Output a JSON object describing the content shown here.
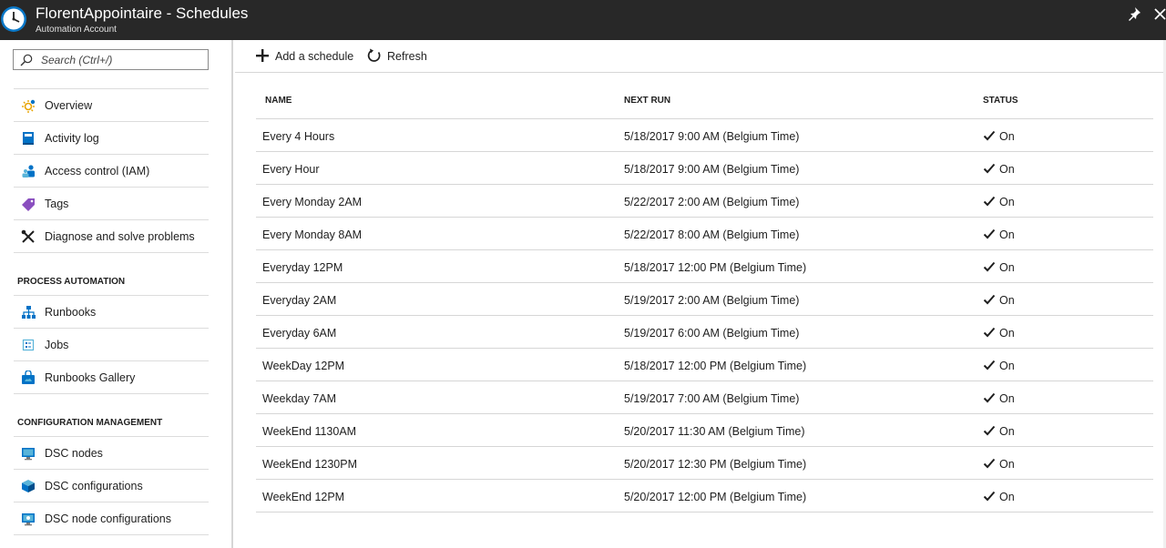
{
  "header": {
    "title": "FlorentAppointaire - Schedules",
    "subtitle": "Automation Account"
  },
  "search": {
    "placeholder": "Search (Ctrl+/)"
  },
  "nav": {
    "items": [
      {
        "label": "Overview",
        "icon": "gear-sun-icon"
      },
      {
        "label": "Activity log",
        "icon": "log-book-icon"
      },
      {
        "label": "Access control (IAM)",
        "icon": "users-icon"
      },
      {
        "label": "Tags",
        "icon": "tag-icon"
      },
      {
        "label": "Diagnose and solve problems",
        "icon": "tools-icon"
      }
    ],
    "sections": [
      {
        "title": "PROCESS AUTOMATION",
        "items": [
          {
            "label": "Runbooks",
            "icon": "hierarchy-icon"
          },
          {
            "label": "Jobs",
            "icon": "list-icon"
          },
          {
            "label": "Runbooks Gallery",
            "icon": "gallery-bag-icon"
          }
        ]
      },
      {
        "title": "CONFIGURATION MANAGEMENT",
        "items": [
          {
            "label": "DSC nodes",
            "icon": "monitor-icon"
          },
          {
            "label": "DSC configurations",
            "icon": "cube-icon"
          },
          {
            "label": "DSC node configurations",
            "icon": "monitor-config-icon"
          }
        ]
      }
    ]
  },
  "toolbar": {
    "add_label": "Add a schedule",
    "refresh_label": "Refresh"
  },
  "table": {
    "columns": [
      "NAME",
      "NEXT RUN",
      "STATUS"
    ],
    "rows": [
      {
        "name": "Every 4 Hours",
        "next_run": "5/18/2017 9:00 AM (Belgium Time)",
        "status": "On"
      },
      {
        "name": "Every Hour",
        "next_run": "5/18/2017 9:00 AM (Belgium Time)",
        "status": "On"
      },
      {
        "name": "Every Monday 2AM",
        "next_run": "5/22/2017 2:00 AM (Belgium Time)",
        "status": "On"
      },
      {
        "name": "Every Monday 8AM",
        "next_run": "5/22/2017 8:00 AM (Belgium Time)",
        "status": "On"
      },
      {
        "name": "Everyday 12PM",
        "next_run": "5/18/2017 12:00 PM (Belgium Time)",
        "status": "On"
      },
      {
        "name": "Everyday 2AM",
        "next_run": "5/19/2017 2:00 AM (Belgium Time)",
        "status": "On"
      },
      {
        "name": "Everyday 6AM",
        "next_run": "5/19/2017 6:00 AM (Belgium Time)",
        "status": "On"
      },
      {
        "name": "WeekDay 12PM",
        "next_run": "5/18/2017 12:00 PM (Belgium Time)",
        "status": "On"
      },
      {
        "name": "Weekday 7AM",
        "next_run": "5/19/2017 7:00 AM (Belgium Time)",
        "status": "On"
      },
      {
        "name": "WeekEnd 1130AM",
        "next_run": "5/20/2017 11:30 AM (Belgium Time)",
        "status": "On"
      },
      {
        "name": "WeekEnd 1230PM",
        "next_run": "5/20/2017 12:30 PM (Belgium Time)",
        "status": "On"
      },
      {
        "name": "WeekEnd 12PM",
        "next_run": "5/20/2017 12:00 PM (Belgium Time)",
        "status": "On"
      }
    ]
  },
  "colors": {
    "header_bg": "#282828",
    "accent_blue": "#0072c6",
    "tag_purple": "#8a4fbf"
  }
}
